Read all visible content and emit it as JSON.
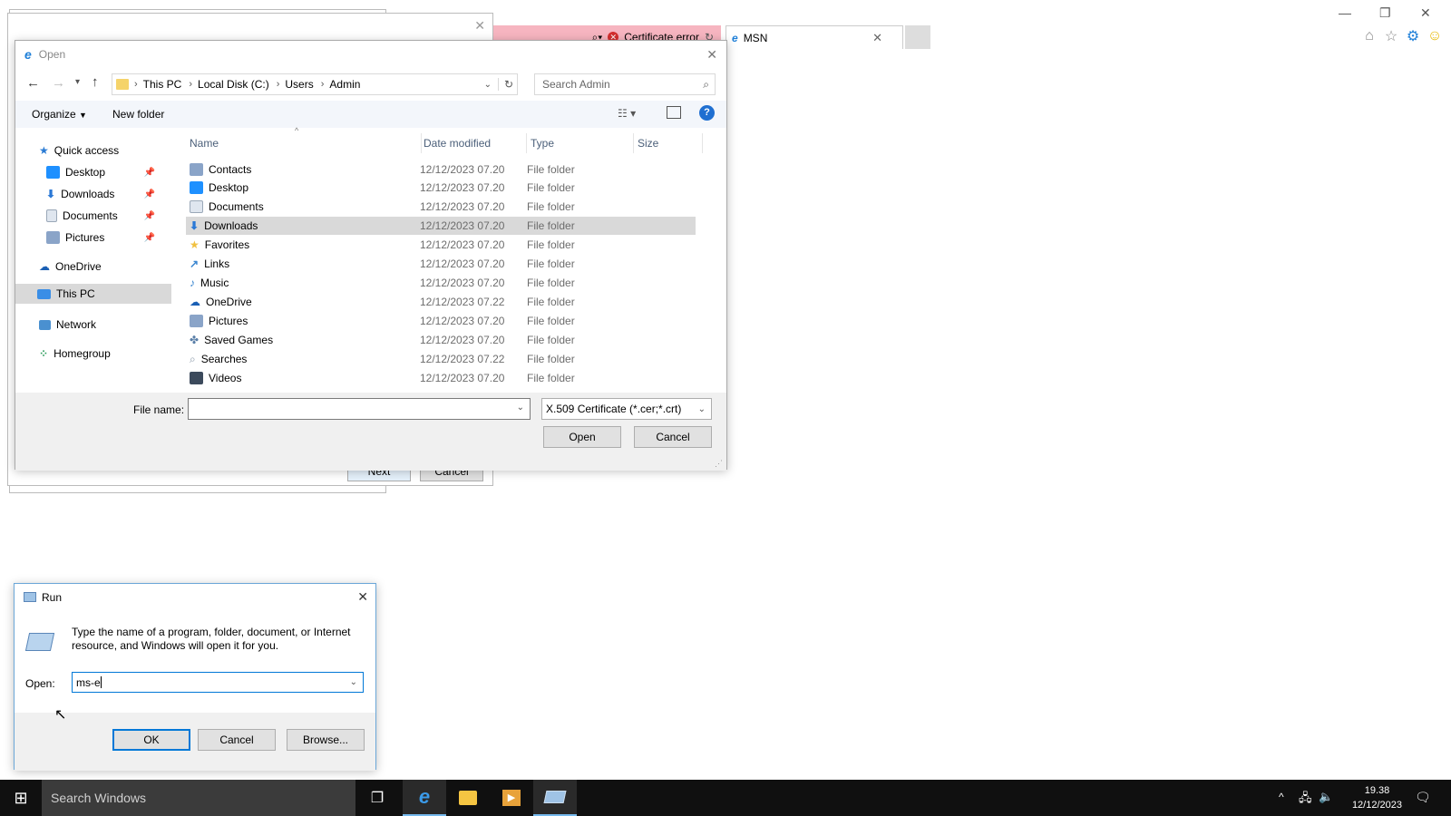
{
  "browser": {
    "tabs": [
      {
        "label": "Certificate error",
        "icon": "ie-logo-icon"
      },
      {
        "label": "MSN",
        "icon": "ie-logo-icon"
      }
    ]
  },
  "open_dialog": {
    "title": "Open",
    "breadcrumb": [
      "This PC",
      "Local Disk (C:)",
      "Users",
      "Admin"
    ],
    "search_placeholder": "Search Admin",
    "toolbar": {
      "organize": "Organize",
      "new_folder": "New folder"
    },
    "nav": [
      {
        "label": "Quick access",
        "icon": "star-icon"
      },
      {
        "label": "Desktop",
        "icon": "desktop-folder-icon"
      },
      {
        "label": "Downloads",
        "icon": "download-arrow-icon"
      },
      {
        "label": "Documents",
        "icon": "document-icon"
      },
      {
        "label": "Pictures",
        "icon": "pictures-icon"
      },
      {
        "label": "OneDrive",
        "icon": "cloud-icon"
      },
      {
        "label": "This PC",
        "icon": "computer-icon"
      },
      {
        "label": "Network",
        "icon": "network-icon"
      },
      {
        "label": "Homegroup",
        "icon": "homegroup-icon"
      }
    ],
    "columns": {
      "name": "Name",
      "date": "Date modified",
      "type": "Type",
      "size": "Size"
    },
    "files": [
      {
        "name": "Contacts",
        "date": "12/12/2023 07.20",
        "type": "File folder",
        "color": "#8aa4c8"
      },
      {
        "name": "Desktop",
        "date": "12/12/2023 07.20",
        "type": "File folder",
        "color": "#1e90ff"
      },
      {
        "name": "Documents",
        "date": "12/12/2023 07.20",
        "type": "File folder",
        "color": "#b8c4d6"
      },
      {
        "name": "Downloads",
        "date": "12/12/2023 07.20",
        "type": "File folder",
        "color": "#2a78d6"
      },
      {
        "name": "Favorites",
        "date": "12/12/2023 07.20",
        "type": "File folder",
        "color": "#f0c040"
      },
      {
        "name": "Links",
        "date": "12/12/2023 07.20",
        "type": "File folder",
        "color": "#3a86d0"
      },
      {
        "name": "Music",
        "date": "12/12/2023 07.20",
        "type": "File folder",
        "color": "#3a86d0"
      },
      {
        "name": "OneDrive",
        "date": "12/12/2023 07.22",
        "type": "File folder",
        "color": "#1a5fb4"
      },
      {
        "name": "Pictures",
        "date": "12/12/2023 07.20",
        "type": "File folder",
        "color": "#8aa4c8"
      },
      {
        "name": "Saved Games",
        "date": "12/12/2023 07.20",
        "type": "File folder",
        "color": "#5a7fa8"
      },
      {
        "name": "Searches",
        "date": "12/12/2023 07.22",
        "type": "File folder",
        "color": "#9aa8b8"
      },
      {
        "name": "Videos",
        "date": "12/12/2023 07.20",
        "type": "File folder",
        "color": "#3c4a5c"
      }
    ],
    "file_name_label": "File name:",
    "file_name_value": "",
    "file_type": "X.509 Certificate (*.cer;*.crt)",
    "open_button": "Open",
    "cancel_button": "Cancel"
  },
  "wizard_buttons": {
    "next": "Next",
    "cancel": "Cancel"
  },
  "run_dialog": {
    "title": "Run",
    "description": "Type the name of a program, folder, document, or Internet resource, and Windows will open it for you.",
    "open_label": "Open:",
    "open_value": "ms-e",
    "ok": "OK",
    "cancel": "Cancel",
    "browse": "Browse..."
  },
  "taskbar": {
    "search_placeholder": "Search Windows",
    "time": "19.38",
    "date": "12/12/2023"
  },
  "colors": {
    "accent": "#0078d7",
    "cert_error_tab": "#f6b5c0",
    "taskbar": "#101010"
  }
}
